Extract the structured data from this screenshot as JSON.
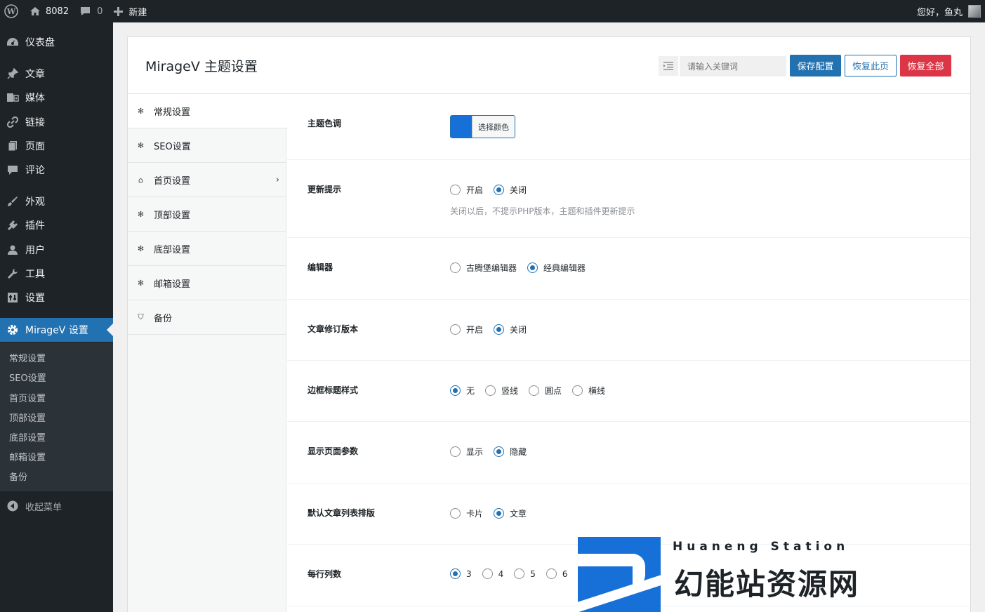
{
  "adminbar": {
    "site_name": "8082",
    "comments_count": "0",
    "new_label": "新建",
    "greeting": "您好，鱼丸"
  },
  "menu": {
    "items": [
      {
        "label": "仪表盘",
        "icon": "dashboard-icon"
      },
      {
        "label": "文章",
        "icon": "pin-icon"
      },
      {
        "label": "媒体",
        "icon": "media-icon"
      },
      {
        "label": "链接",
        "icon": "link-icon"
      },
      {
        "label": "页面",
        "icon": "page-icon"
      },
      {
        "label": "评论",
        "icon": "comment-icon"
      },
      {
        "label": "外观",
        "icon": "brush-icon"
      },
      {
        "label": "插件",
        "icon": "plugin-icon"
      },
      {
        "label": "用户",
        "icon": "user-icon"
      },
      {
        "label": "工具",
        "icon": "wrench-icon"
      },
      {
        "label": "设置",
        "icon": "settings-icon"
      },
      {
        "label": "MirageV 设置",
        "icon": "gear-icon"
      }
    ],
    "submenu": [
      "常规设置",
      "SEO设置",
      "首页设置",
      "顶部设置",
      "底部设置",
      "邮箱设置",
      "备份"
    ],
    "collapse_label": "收起菜单"
  },
  "panel": {
    "title": "MirageV 主题设置",
    "search_placeholder": "请输入关键词",
    "save_label": "保存配置",
    "restore_label": "恢复此页",
    "reset_label": "恢复全部"
  },
  "tabs": [
    {
      "label": "常规设置",
      "icon": "gear-icon"
    },
    {
      "label": "SEO设置",
      "icon": "gear-icon"
    },
    {
      "label": "首页设置",
      "icon": "home-icon"
    },
    {
      "label": "顶部设置",
      "icon": "gear-icon"
    },
    {
      "label": "底部设置",
      "icon": "gear-icon"
    },
    {
      "label": "邮箱设置",
      "icon": "gear-icon"
    },
    {
      "label": "备份",
      "icon": "shield-icon"
    }
  ],
  "fields": {
    "theme_color": {
      "label": "主题色调",
      "button_label": "选择颜色",
      "color": "#1770d8"
    },
    "update_notice": {
      "label": "更新提示",
      "options": [
        "开启",
        "关闭"
      ],
      "selected": 1,
      "desc": "关闭以后，不提示PHP版本，主题和插件更新提示"
    },
    "editor": {
      "label": "编辑器",
      "options": [
        "古腾堡编辑器",
        "经典编辑器"
      ],
      "selected": 1
    },
    "revisions": {
      "label": "文章修订版本",
      "options": [
        "开启",
        "关闭"
      ],
      "selected": 1
    },
    "border_title": {
      "label": "边框标题样式",
      "options": [
        "无",
        "竖线",
        "圆点",
        "横线"
      ],
      "selected": 0
    },
    "page_params": {
      "label": "显示页面参数",
      "options": [
        "显示",
        "隐藏"
      ],
      "selected": 1
    },
    "list_layout": {
      "label": "默认文章列表排版",
      "options": [
        "卡片",
        "文章"
      ],
      "selected": 1
    },
    "columns": {
      "label": "每行列数",
      "options": [
        "3",
        "4",
        "5",
        "6"
      ],
      "selected": 0
    }
  },
  "logo": {
    "english": "Huaneng Station",
    "chinese": "幻能站资源网"
  },
  "colors": {
    "accent": "#2271b1",
    "danger": "#dc3545",
    "admin_dark": "#1d2327"
  }
}
